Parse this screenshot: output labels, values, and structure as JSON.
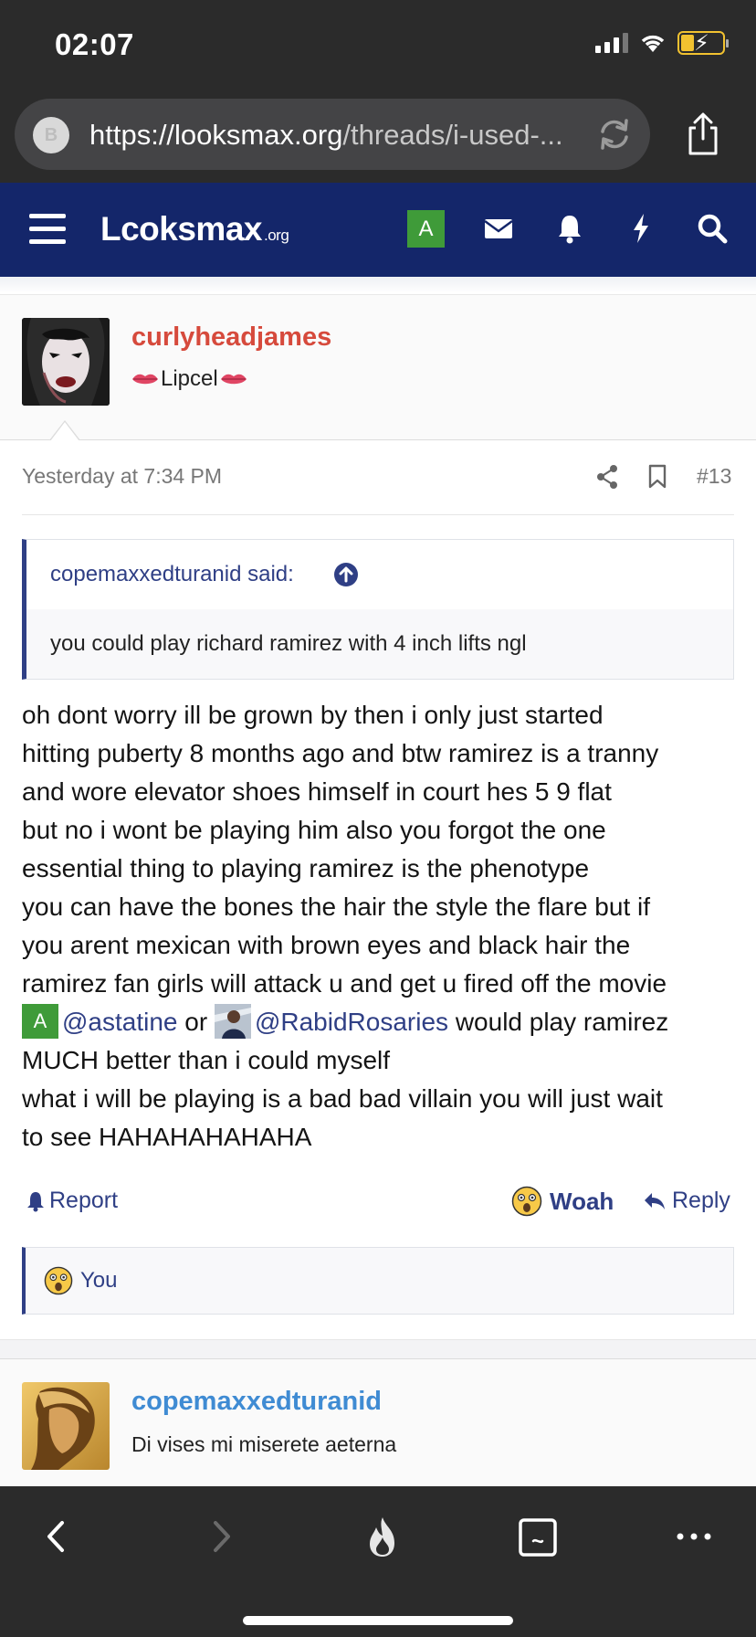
{
  "status_bar": {
    "time": "02:07"
  },
  "browser": {
    "url_host": "https://looksmax.org",
    "url_path": "/threads/i-used-...",
    "favicon_letter": "B"
  },
  "nav": {
    "logo_text": "Lcoksmax",
    "logo_suffix": ".org",
    "account_letter": "A",
    "accent_color": "#14266a"
  },
  "post": {
    "author": "curlyheadjames",
    "author_title": "Lipcel",
    "author_color": "#d64a3c",
    "timestamp": "Yesterday at 7:34 PM",
    "post_number": "#13",
    "quote": {
      "author": "copemaxxedturanid said:",
      "text": "you could play richard ramirez with 4 inch lifts ngl"
    },
    "body": {
      "l1": "oh dont worry ill be grown by then i only just started",
      "l2": "hitting puberty 8 months ago and btw ramirez is a tranny",
      "l3": "and wore elevator shoes himself in court hes 5 9 flat",
      "l4": "but no i wont be playing him also you forgot the one",
      "l5": "essential thing to playing ramirez is the phenotype",
      "l6": "you can have the bones the hair the style the flare but if",
      "l7": "you arent mexican with brown eyes and black hair the",
      "l8": "ramirez fan girls will attack u and get u fired off the movie",
      "mention1_avatar": "A",
      "mention1": "@astatine",
      "or": " or ",
      "mention2": "@RabidRosaries",
      "l9_tail": " would play ramirez",
      "l10": "MUCH better than i could myself",
      "l11": "what i will be playing is a bad bad villain you will just wait",
      "l12": "to see HAHAHAHAHAHA"
    },
    "actions": {
      "report": "Report",
      "woah": "Woah",
      "reply": "Reply"
    },
    "reactions": {
      "text": "You"
    }
  },
  "next_post": {
    "author": "copemaxxedturanid",
    "author_title": "Di vises mi miserete aeterna",
    "author_color": "#3f8bd3"
  }
}
